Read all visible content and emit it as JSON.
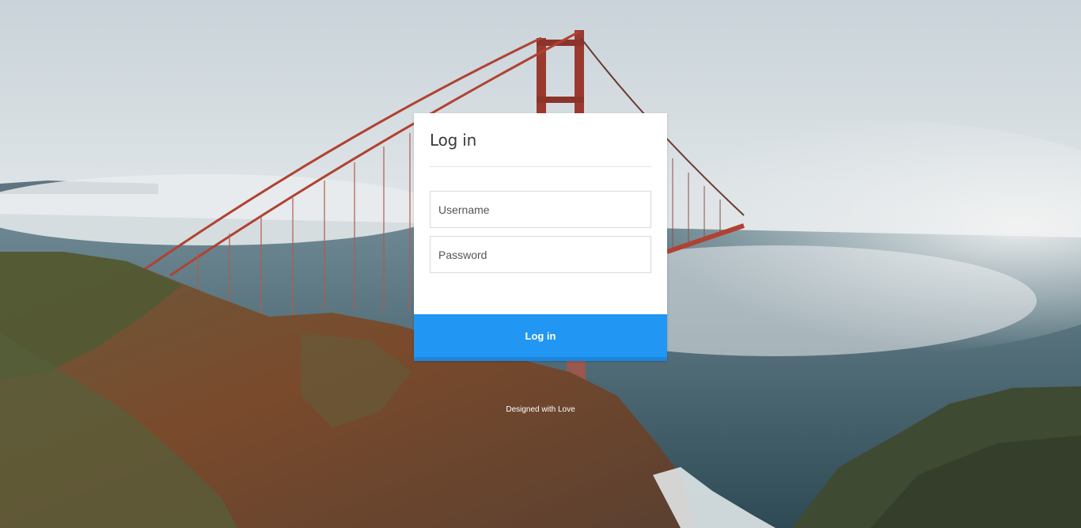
{
  "background": {
    "description_icon": "golden-gate-bridge-photo"
  },
  "login_card": {
    "title": "Log in",
    "username_placeholder": "Username",
    "password_placeholder": "Password",
    "submit_label": "Log in"
  },
  "footer": {
    "text": "Designed with Love"
  },
  "colors": {
    "primary_button": "#2196f3",
    "card_bg": "#ffffff"
  }
}
